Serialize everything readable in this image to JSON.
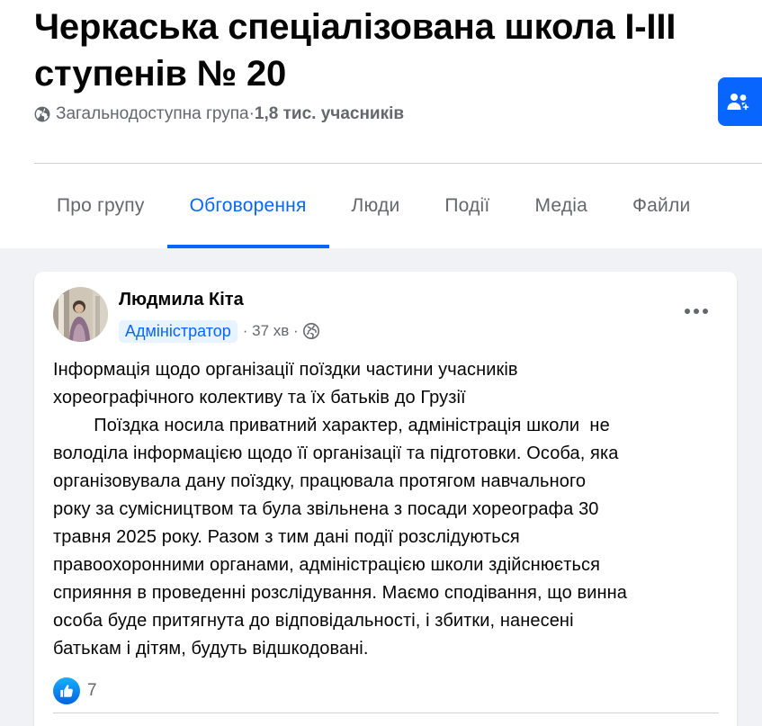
{
  "group": {
    "title": "Черкаська спеціалізована школа I-III ступенів № 20",
    "privacy": "Загальнодоступна група",
    "separator": " · ",
    "members": "1,8 тис. учасників",
    "join_icon": "people-icon"
  },
  "tabs": [
    {
      "label": "Про групу",
      "active": false
    },
    {
      "label": "Обговорення",
      "active": true
    },
    {
      "label": "Люди",
      "active": false
    },
    {
      "label": "Події",
      "active": false
    },
    {
      "label": "Медіа",
      "active": false
    },
    {
      "label": "Файли",
      "active": false
    }
  ],
  "post": {
    "author": "Людмила Кіта",
    "role": "Адміністратор",
    "time": "· 37 хв ·",
    "visibility_icon": "globe-icon",
    "more_icon": "more-options-icon",
    "text": "Інформація щодо організації поїздки частини учасників\nхореографічного колективу та їх батьків до Грузії\n        Поїздка носила приватний характер, адміністрація школи  не\nволоділа інформацією щодо її організації та підготовки. Особа, яка\nорганізовувала дану поїздку, працювала протягом навчального\nроку за сумісництвом та була звільнена з посади хореографа 30\nтравня 2025 року. Разом з тим дані події розслідуються\nправоохоронними органами, адміністрацією школи здійснюється\nсприяння в проведенні розслідування. Маємо сподівання, що винна\nособа буде притягнута до відповідальності, і збитки, нанесені\nбатькам і дітям, будуть відшкодовані.",
    "reaction_icon": "like-icon",
    "reaction_count": "7"
  },
  "colors": {
    "accent": "#0866ff",
    "secondary_text": "#65676b",
    "background": "#f0f2f5"
  }
}
